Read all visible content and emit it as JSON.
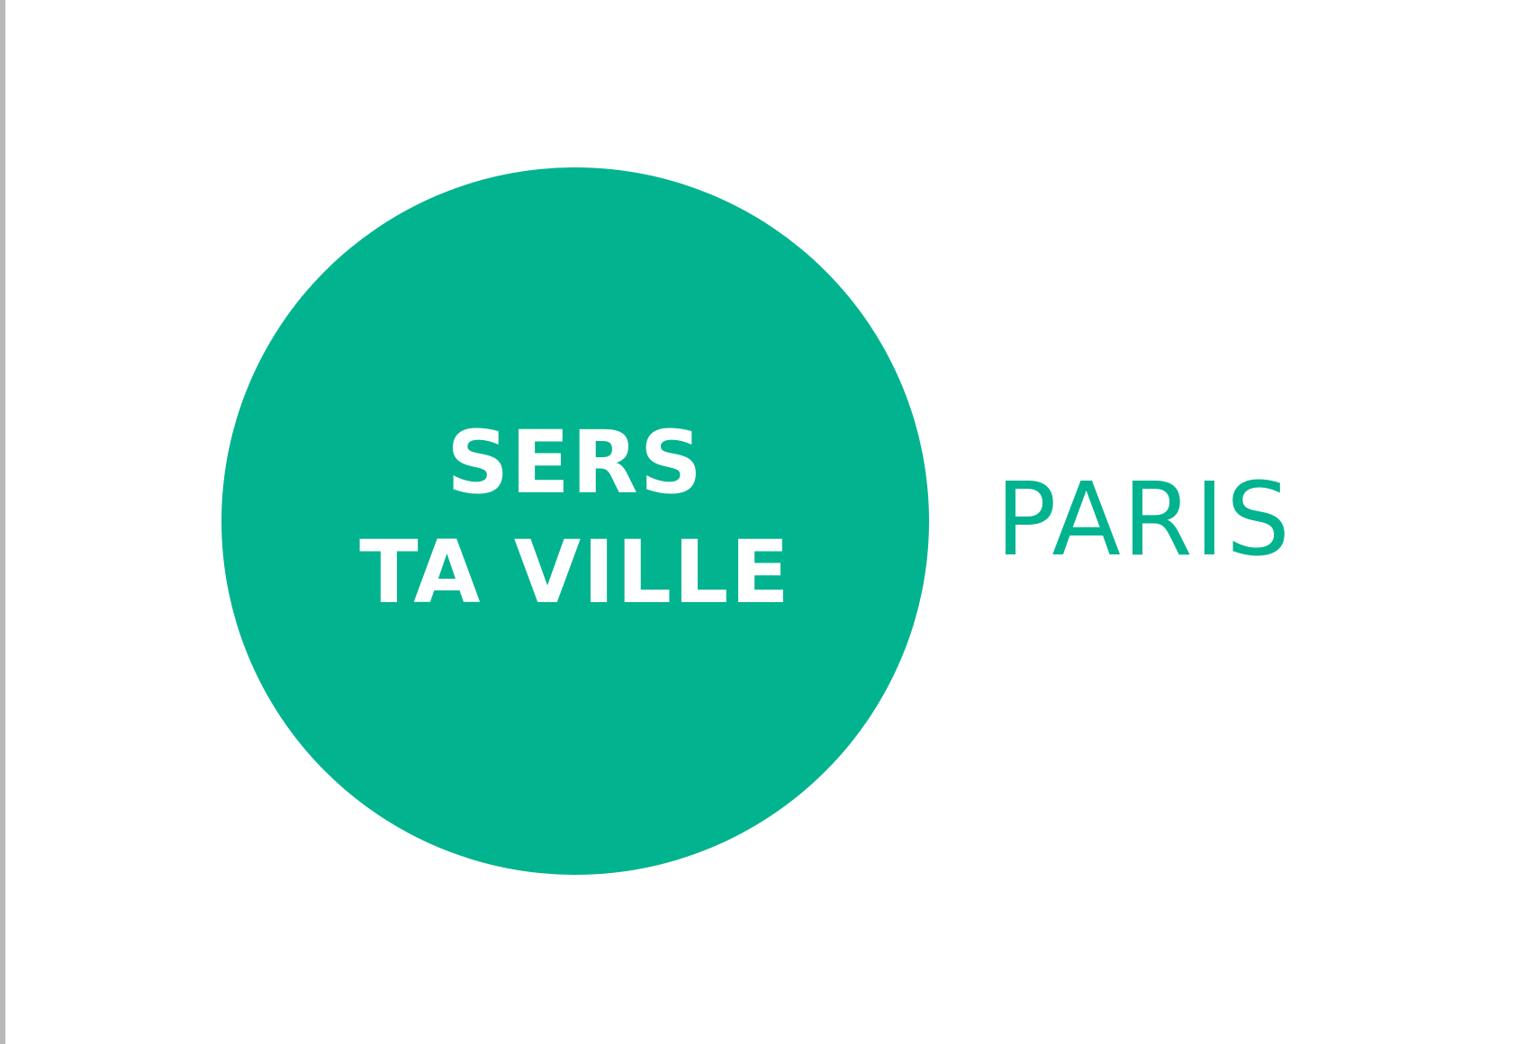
{
  "logo": {
    "line_1": "SERS",
    "line_2": "TA VILLE",
    "city": "PARIS"
  },
  "colors": {
    "brand_green": "#02b38f",
    "text_on_brand": "#ffffff",
    "background": "#ffffff"
  }
}
